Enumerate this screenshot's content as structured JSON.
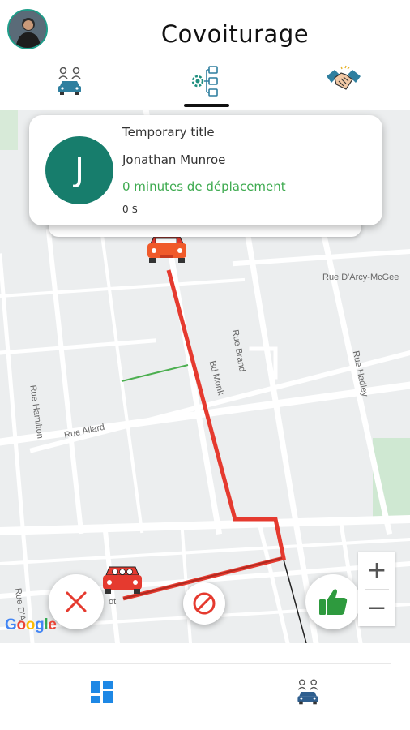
{
  "header": {
    "title": "Covoiturage",
    "tabs": [
      {
        "icon": "carpool-people-icon"
      },
      {
        "icon": "settings-org-icon",
        "active": true
      },
      {
        "icon": "handshake-icon"
      }
    ]
  },
  "trip_card": {
    "initial": "J",
    "title": "Temporary title",
    "driver_name": "Jonathan Munroe",
    "duration": "0 minutes de déplacement",
    "price": "0 $"
  },
  "map": {
    "streets": [
      "Rue D'Arcy-McGee",
      "Rue Brand",
      "Rue Hadley",
      "Rue Hamilton",
      "Rue Allard",
      "Bd Monk",
      "Rue D'A",
      "ot"
    ],
    "route_color": "#e53a2f",
    "attribution": "Google",
    "zoom_in_label": "+",
    "zoom_out_label": "−"
  },
  "actions": {
    "reject_icon": "close-icon",
    "cancel_icon": "block-icon",
    "accept_icon": "thumbs-up-icon"
  },
  "bottom_nav": [
    {
      "icon": "dashboard-icon"
    },
    {
      "icon": "carpool-people-icon"
    }
  ],
  "colors": {
    "teal": "#177d6c",
    "green_text": "#3daa4f",
    "red": "#e53a2f",
    "blue": "#1e88e5"
  }
}
